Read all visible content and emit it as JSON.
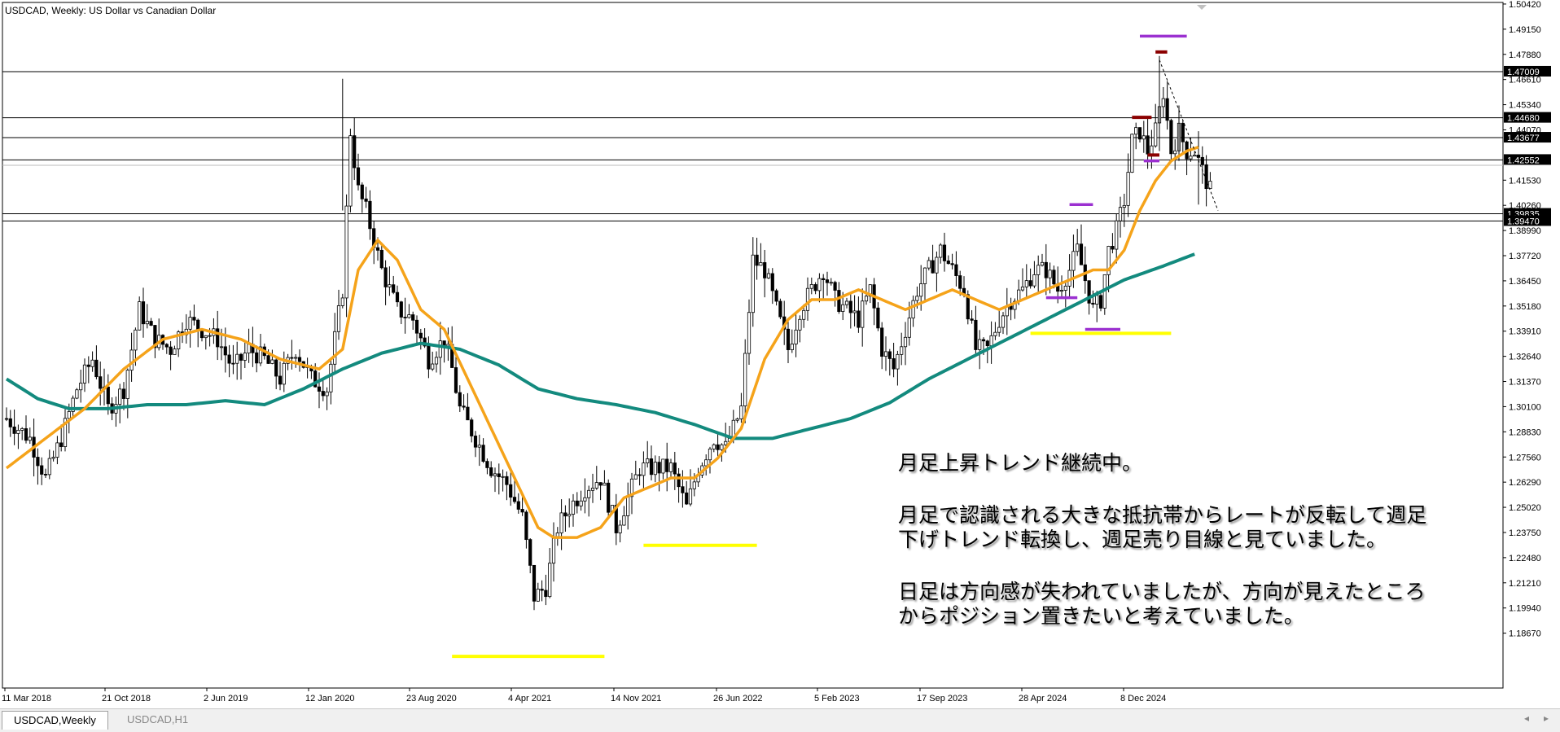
{
  "chart_title": "USDCAD, Weekly:  US Dollar vs Canadian Dollar",
  "tabs": [
    {
      "label": "USDCAD,Weekly",
      "active": true
    },
    {
      "label": "USDCAD,H1",
      "active": false
    }
  ],
  "annotation": {
    "p1": "月足上昇トレンド継続中。",
    "p2": "月足で認識される大きな抵抗帯からレートが反転して週足下げトレンド転換し、週足売り目線と見ていました。",
    "p3": "日足は方向感が失われていましたが、方向が見えたところからポジション置きたいと考えていました。"
  },
  "colors": {
    "ma_fast": "#f5a31a",
    "ma_slow": "#138a7e",
    "support_line": "#ffff00",
    "marker_purple": "#9b30d0",
    "marker_red": "#8b0000",
    "candle": "#000000"
  },
  "chart_data": {
    "type": "candlestick",
    "symbol": "USDCAD",
    "timeframe": "Weekly",
    "ylim": [
      1.159,
      1.505
    ],
    "y_ticks": [
      "1.50420",
      "1.49150",
      "1.47880",
      "1.46610",
      "1.45340",
      "1.44070",
      "1.41530",
      "1.40260",
      "1.38990",
      "1.37720",
      "1.36450",
      "1.35180",
      "1.33910",
      "1.32640",
      "1.31370",
      "1.30100",
      "1.28830",
      "1.27560",
      "1.26290",
      "1.25020",
      "1.23750",
      "1.22480",
      "1.21210",
      "1.19940",
      "1.18670"
    ],
    "x_ticks": [
      "11 Mar 2018",
      "21 Oct 2018",
      "2 Jun 2019",
      "12 Jan 2020",
      "23 Aug 2020",
      "4 Apr 2021",
      "14 Nov 2021",
      "26 Jun 2022",
      "5 Feb 2023",
      "17 Sep 2023",
      "28 Apr 2024",
      "8 Dec 2024"
    ],
    "horizontal_levels": [
      {
        "value": 1.47009,
        "label": "1.47009"
      },
      {
        "value": 1.4468,
        "label": "1.44680"
      },
      {
        "value": 1.43677,
        "label": "1.43677"
      },
      {
        "value": 1.42552,
        "label": "1.42552"
      },
      {
        "value": 1.39835,
        "label": "1.39835"
      },
      {
        "value": 1.3947,
        "label": "1.39470"
      }
    ],
    "price_path": [
      [
        0,
        1.295
      ],
      [
        6,
        1.285
      ],
      [
        10,
        1.265
      ],
      [
        14,
        1.285
      ],
      [
        18,
        1.31
      ],
      [
        22,
        1.325
      ],
      [
        26,
        1.3
      ],
      [
        30,
        1.31
      ],
      [
        34,
        1.35
      ],
      [
        38,
        1.335
      ],
      [
        42,
        1.33
      ],
      [
        46,
        1.345
      ],
      [
        50,
        1.34
      ],
      [
        54,
        1.335
      ],
      [
        58,
        1.32
      ],
      [
        62,
        1.33
      ],
      [
        66,
        1.325
      ],
      [
        70,
        1.315
      ],
      [
        74,
        1.33
      ],
      [
        78,
        1.315
      ],
      [
        82,
        1.31
      ],
      [
        86,
        1.36
      ],
      [
        88,
        1.44
      ],
      [
        90,
        1.41
      ],
      [
        92,
        1.4
      ],
      [
        96,
        1.37
      ],
      [
        100,
        1.35
      ],
      [
        104,
        1.345
      ],
      [
        108,
        1.325
      ],
      [
        112,
        1.335
      ],
      [
        114,
        1.32
      ],
      [
        116,
        1.3
      ],
      [
        120,
        1.285
      ],
      [
        124,
        1.27
      ],
      [
        128,
        1.262
      ],
      [
        132,
        1.245
      ],
      [
        135,
        1.205
      ],
      [
        138,
        1.21
      ],
      [
        141,
        1.24
      ],
      [
        144,
        1.25
      ],
      [
        148,
        1.26
      ],
      [
        152,
        1.265
      ],
      [
        156,
        1.24
      ],
      [
        158,
        1.25
      ],
      [
        162,
        1.27
      ],
      [
        166,
        1.27
      ],
      [
        170,
        1.27
      ],
      [
        174,
        1.25
      ],
      [
        177,
        1.27
      ],
      [
        181,
        1.285
      ],
      [
        184,
        1.28
      ],
      [
        188,
        1.3
      ],
      [
        191,
        1.375
      ],
      [
        194,
        1.37
      ],
      [
        197,
        1.35
      ],
      [
        200,
        1.33
      ],
      [
        203,
        1.35
      ],
      [
        206,
        1.36
      ],
      [
        209,
        1.37
      ],
      [
        212,
        1.355
      ],
      [
        215,
        1.35
      ],
      [
        218,
        1.345
      ],
      [
        221,
        1.36
      ],
      [
        224,
        1.33
      ],
      [
        227,
        1.32
      ],
      [
        230,
        1.34
      ],
      [
        233,
        1.36
      ],
      [
        236,
        1.37
      ],
      [
        239,
        1.38
      ],
      [
        242,
        1.37
      ],
      [
        245,
        1.36
      ],
      [
        248,
        1.33
      ],
      [
        251,
        1.33
      ],
      [
        254,
        1.345
      ],
      [
        257,
        1.355
      ],
      [
        260,
        1.36
      ],
      [
        263,
        1.37
      ],
      [
        266,
        1.37
      ],
      [
        269,
        1.36
      ],
      [
        272,
        1.37
      ],
      [
        274,
        1.38
      ],
      [
        276,
        1.365
      ],
      [
        278,
        1.35
      ],
      [
        280,
        1.355
      ],
      [
        282,
        1.38
      ],
      [
        284,
        1.39
      ],
      [
        286,
        1.405
      ],
      [
        288,
        1.435
      ],
      [
        290,
        1.44
      ],
      [
        292,
        1.43
      ],
      [
        294,
        1.44
      ],
      [
        296,
        1.46
      ],
      [
        298,
        1.43
      ],
      [
        300,
        1.44
      ],
      [
        302,
        1.43
      ],
      [
        304,
        1.43
      ],
      [
        306,
        1.42
      ],
      [
        308,
        1.41
      ]
    ],
    "ma_fast_path": [
      [
        0,
        1.27
      ],
      [
        10,
        1.285
      ],
      [
        20,
        1.3
      ],
      [
        30,
        1.32
      ],
      [
        40,
        1.335
      ],
      [
        50,
        1.34
      ],
      [
        60,
        1.335
      ],
      [
        70,
        1.325
      ],
      [
        80,
        1.32
      ],
      [
        86,
        1.33
      ],
      [
        90,
        1.37
      ],
      [
        95,
        1.385
      ],
      [
        100,
        1.375
      ],
      [
        106,
        1.35
      ],
      [
        112,
        1.34
      ],
      [
        118,
        1.315
      ],
      [
        124,
        1.29
      ],
      [
        130,
        1.265
      ],
      [
        136,
        1.24
      ],
      [
        140,
        1.235
      ],
      [
        146,
        1.235
      ],
      [
        152,
        1.24
      ],
      [
        158,
        1.255
      ],
      [
        164,
        1.26
      ],
      [
        170,
        1.265
      ],
      [
        176,
        1.265
      ],
      [
        182,
        1.275
      ],
      [
        188,
        1.29
      ],
      [
        194,
        1.325
      ],
      [
        200,
        1.345
      ],
      [
        206,
        1.355
      ],
      [
        212,
        1.355
      ],
      [
        218,
        1.36
      ],
      [
        224,
        1.355
      ],
      [
        230,
        1.35
      ],
      [
        236,
        1.355
      ],
      [
        242,
        1.36
      ],
      [
        248,
        1.355
      ],
      [
        254,
        1.35
      ],
      [
        260,
        1.355
      ],
      [
        266,
        1.36
      ],
      [
        272,
        1.365
      ],
      [
        278,
        1.37
      ],
      [
        282,
        1.37
      ],
      [
        286,
        1.38
      ],
      [
        290,
        1.4
      ],
      [
        294,
        1.415
      ],
      [
        298,
        1.425
      ],
      [
        302,
        1.43
      ],
      [
        305,
        1.432
      ]
    ],
    "ma_slow_path": [
      [
        0,
        1.315
      ],
      [
        8,
        1.305
      ],
      [
        16,
        1.3
      ],
      [
        26,
        1.3
      ],
      [
        36,
        1.302
      ],
      [
        46,
        1.302
      ],
      [
        56,
        1.304
      ],
      [
        66,
        1.302
      ],
      [
        76,
        1.31
      ],
      [
        86,
        1.32
      ],
      [
        96,
        1.328
      ],
      [
        106,
        1.333
      ],
      [
        116,
        1.33
      ],
      [
        126,
        1.322
      ],
      [
        136,
        1.31
      ],
      [
        146,
        1.305
      ],
      [
        156,
        1.302
      ],
      [
        166,
        1.298
      ],
      [
        176,
        1.292
      ],
      [
        186,
        1.285
      ],
      [
        196,
        1.285
      ],
      [
        206,
        1.29
      ],
      [
        216,
        1.295
      ],
      [
        226,
        1.303
      ],
      [
        236,
        1.315
      ],
      [
        246,
        1.325
      ],
      [
        256,
        1.335
      ],
      [
        266,
        1.345
      ],
      [
        276,
        1.355
      ],
      [
        286,
        1.365
      ],
      [
        296,
        1.372
      ],
      [
        304,
        1.378
      ]
    ],
    "support_segments": [
      {
        "x1": 114,
        "x2": 153,
        "y": 1.175
      },
      {
        "x1": 163,
        "x2": 192,
        "y": 1.231
      },
      {
        "x1": 262,
        "x2": 298,
        "y": 1.338
      }
    ],
    "purple_markers": [
      {
        "x1": 290,
        "x2": 302,
        "y": 1.488
      },
      {
        "x1": 272,
        "x2": 278,
        "y": 1.403
      },
      {
        "x1": 266,
        "x2": 274,
        "y": 1.356
      },
      {
        "x1": 276,
        "x2": 285,
        "y": 1.34
      },
      {
        "x1": 291,
        "x2": 295,
        "y": 1.425
      }
    ],
    "red_markers": [
      {
        "x1": 294,
        "x2": 297,
        "y": 1.48
      },
      {
        "x1": 288,
        "x2": 293,
        "y": 1.447
      },
      {
        "x1": 292,
        "x2": 295,
        "y": 1.428
      }
    ]
  }
}
